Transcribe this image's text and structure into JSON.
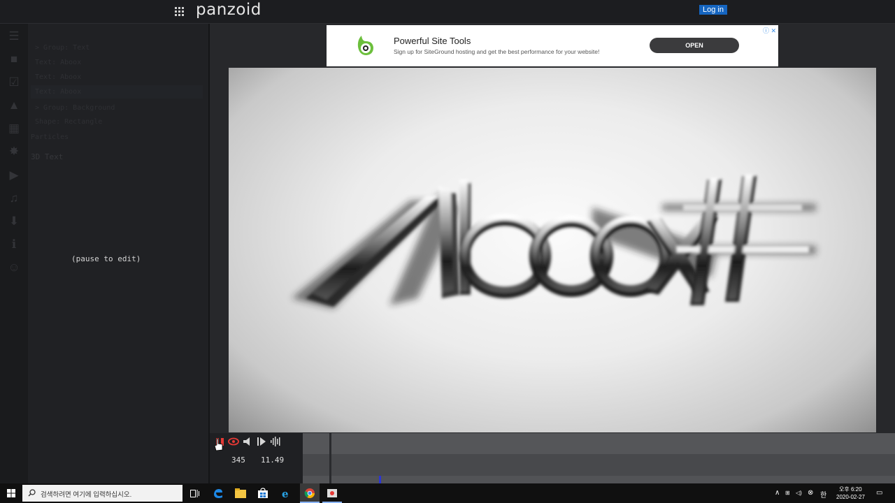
{
  "app": {
    "logo": "panzoid",
    "login_label": "Log in"
  },
  "panel": {
    "lines": [
      "> Group: Text",
      "Text: Aboox",
      "Text: Aboox",
      "Text: Aboox",
      "> Group: Background",
      "Shape: Rectangle",
      "Particles"
    ],
    "section_title": "3D Text",
    "overlay_text": "(pause to edit)"
  },
  "ad": {
    "title": "Powerful Site Tools",
    "subtitle": "Sign up for SiteGround hosting and get the best performance for your website!",
    "button": "OPEN",
    "choices": "ⓘ ✕"
  },
  "preview": {
    "text": "Aboox#"
  },
  "timeline": {
    "frame": "345",
    "time": "11.49"
  },
  "taskbar": {
    "search_placeholder": "검색하려면 여기에 입력하십시오.",
    "time": "오후 6:20",
    "date": "2020-02-27",
    "ime": "한"
  },
  "colors": {
    "accent_login": "#1565c0",
    "record": "#e53935",
    "playhead_marker": "#2b35d4"
  },
  "icons": [
    "apps-grid-icon",
    "menu-icon",
    "folder-icon",
    "checkbox-icon",
    "image-icon",
    "layers-icon",
    "burst-icon",
    "video-icon",
    "music-icon",
    "download-icon",
    "info-icon",
    "smile-icon",
    "record-icon",
    "eye-icon",
    "volume-icon",
    "play-icon",
    "waveform-icon",
    "windows-start-icon",
    "search-icon"
  ]
}
